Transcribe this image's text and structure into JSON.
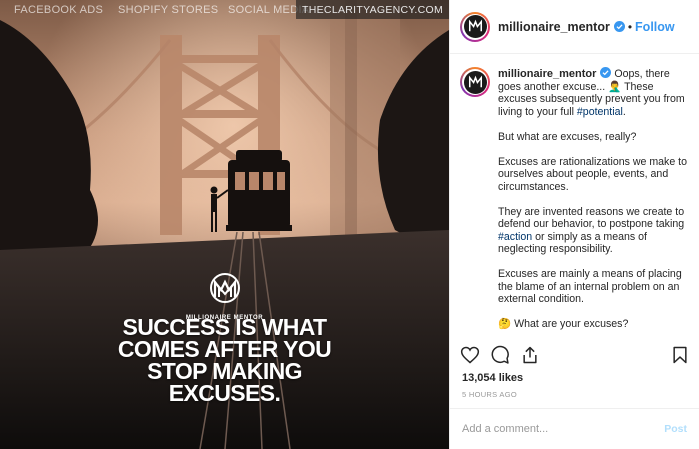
{
  "watermark_nav": {
    "facebook_ads": "FACEBOOK ADS",
    "shopify_stores": "SHOPIFY STORES",
    "social_media": "SOCIAL MEDIA",
    "agency": "THECLARITYAGENCY.COM"
  },
  "image": {
    "brand_text": "MILLIONAIRE MENTOR",
    "quote_lines": [
      "SUCCESS IS WHAT",
      "COMES AFTER YOU",
      "STOP MAKING",
      "EXCUSES."
    ]
  },
  "header": {
    "username": "millionaire_mentor",
    "separator": "•",
    "follow_label": "Follow"
  },
  "caption": {
    "username": "millionaire_mentor",
    "intro": " Oops, there goes another excuse... 🤦‍♂️ These excuses subsequently prevent you from living to your full ",
    "hashtag_potential": "#potential",
    "intro_end": ".",
    "p2": "But what are excuses, really?",
    "p3": "Excuses are rationalizations we make to ourselves about people, events, and circumstances.",
    "p4a": "They are invented reasons we create to defend our behavior, to postpone taking",
    "hashtag_action": "#action",
    "p4b": " or simply as a means of neglecting responsibility.",
    "p5": "Excuses are mainly a means of placing the blame of an internal problem on an external condition.",
    "p6": "🤔 What are your excuses?"
  },
  "likes": "13,054 likes",
  "timestamp": "5 HOURS AGO",
  "comment_box": {
    "placeholder": "Add a comment...",
    "post_label": "Post"
  },
  "colors": {
    "link_blue": "#3897f0",
    "hashtag": "#003569",
    "post_disabled": "#b2dffc"
  },
  "icons": [
    "heart-icon",
    "comment-icon",
    "share-icon",
    "bookmark-icon",
    "verified-badge-icon"
  ]
}
